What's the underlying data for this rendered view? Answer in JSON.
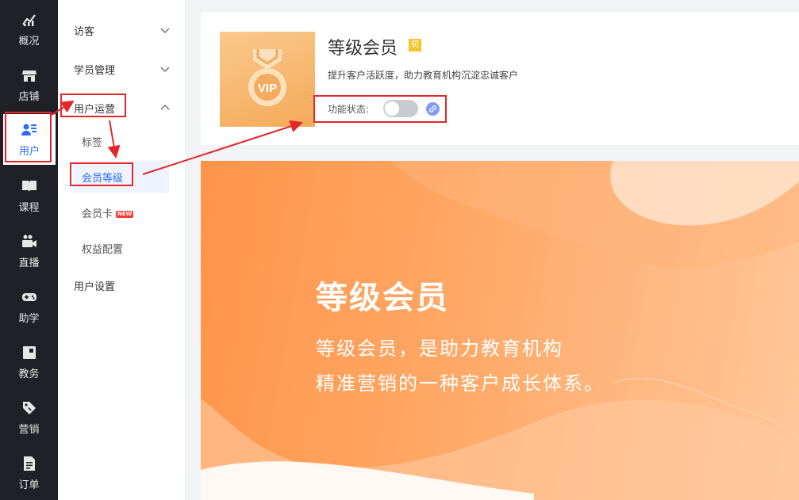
{
  "rail": {
    "items": [
      {
        "label": "概况",
        "icon": "chart-icon"
      },
      {
        "label": "店铺",
        "icon": "store-icon"
      },
      {
        "label": "用户",
        "icon": "users-icon"
      },
      {
        "label": "课程",
        "icon": "book-icon"
      },
      {
        "label": "直播",
        "icon": "video-icon"
      },
      {
        "label": "助学",
        "icon": "gamepad-icon"
      },
      {
        "label": "教务",
        "icon": "calendar-icon"
      },
      {
        "label": "营销",
        "icon": "tag-icon"
      },
      {
        "label": "订单",
        "icon": "order-icon"
      }
    ],
    "active_index": 2
  },
  "submenu": {
    "visitor": "访客",
    "student_mgmt": "学员管理",
    "user_ops": "用户运营",
    "children": {
      "tags": "标签",
      "member_level": "会员等级",
      "member_card": "会员卡",
      "member_card_badge": "NEW",
      "rights_config": "权益配置"
    },
    "user_settings": "用户设置"
  },
  "card": {
    "title": "等级会员",
    "title_badge": "初",
    "description": "提升客户活跃度，助力教育机构沉淀忠诚客户",
    "status_label": "功能状态:",
    "toggle_on": false,
    "thumb_text": "VIP"
  },
  "banner": {
    "title": "等级会员",
    "line1": "等级会员，是助力教育机构",
    "line2": "精准营销的一种客户成长体系。"
  },
  "colors": {
    "accent": "#2c6cf5",
    "annotation": "#e4262c",
    "banner_orange": "#ff9448"
  }
}
